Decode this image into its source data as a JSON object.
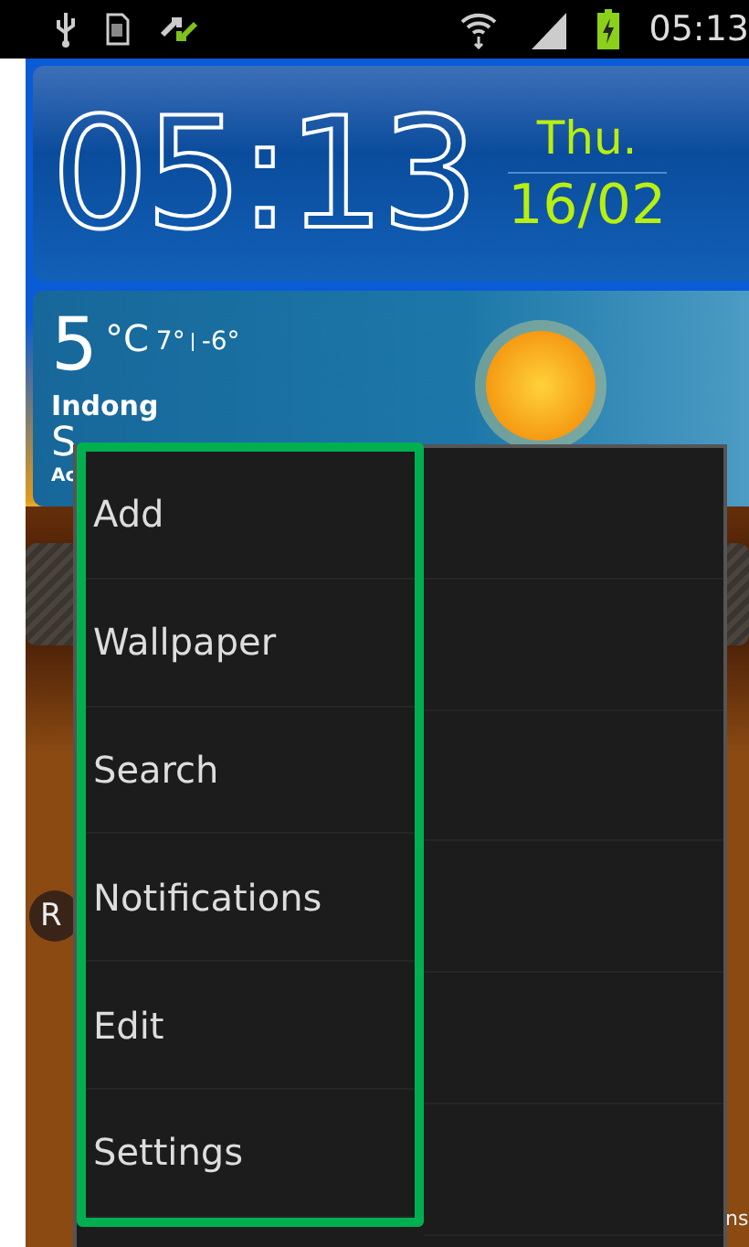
{
  "status_bar": {
    "time": "05:13"
  },
  "clock": {
    "time": "05:13",
    "day": "Thu.",
    "date": "16/02"
  },
  "weather": {
    "temperature": "5",
    "unit": "°C",
    "high": "7°",
    "low": "-6°",
    "location": "Indong",
    "condition": "S",
    "updated": "Ac"
  },
  "background_labels": [
    {
      "text": "R",
      "kind": "pill"
    },
    {
      "text": "ns",
      "kind": "caption"
    }
  ],
  "menu": {
    "items": [
      {
        "label": "Add"
      },
      {
        "label": "Wallpaper"
      },
      {
        "label": "Search"
      },
      {
        "label": "Notifications"
      },
      {
        "label": "Edit"
      },
      {
        "label": "Settings"
      }
    ]
  }
}
